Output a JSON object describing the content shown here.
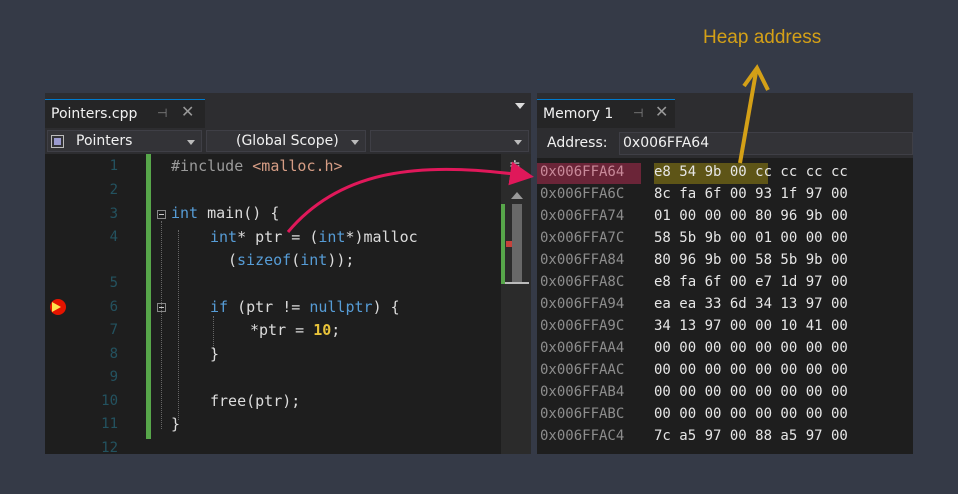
{
  "annotation": {
    "label": "Heap address",
    "label_color": "#d4a017",
    "arrow_color": "#d4a017",
    "pointer_arrow_color": "#e0185a"
  },
  "editor": {
    "tab_title": "Pointers.cpp",
    "pin_glyph": "⊣",
    "close_glyph": "✕",
    "nav": {
      "project": "Pointers",
      "scope": "(Global Scope)",
      "member": ""
    },
    "line_numbers": [
      "1",
      "2",
      "3",
      "4",
      "",
      "5",
      "6",
      "7",
      "8",
      "9",
      "10",
      "11",
      "12"
    ],
    "breakpoint_line": "6",
    "code": {
      "l1_directive": "#include",
      "l1_header": "<malloc.h>",
      "l3_kw": "int",
      "l3_rest": " main() {",
      "l4_kw": "int",
      "l4_rest": "* ptr = (",
      "l4_kw2": "int",
      "l4_rest2": "*)malloc",
      "l4w_open": "(",
      "l4w_kw": "sizeof",
      "l4w_mid": "(",
      "l4w_kw2": "int",
      "l4w_end": "));",
      "l6_kw": "if",
      "l6_mid": " (ptr != ",
      "l6_kw2": "nullptr",
      "l6_end": ") {",
      "l7_pre": "*ptr = ",
      "l7_num": "10",
      "l7_end": ";",
      "l8": "}",
      "l10": "free(ptr);",
      "l11": "}"
    }
  },
  "memory": {
    "tab_title": "Memory 1",
    "pin_glyph": "⊣",
    "close_glyph": "✕",
    "address_label": "Address:",
    "address_value": "0x006FFA64",
    "rows": [
      {
        "addr": "0x006FFA64",
        "hl": "e8 54 9b 00",
        "rest": " cc cc cc cc"
      },
      {
        "addr": "0x006FFA6C",
        "bytes": "8c fa 6f 00 93 1f 97 00"
      },
      {
        "addr": "0x006FFA74",
        "bytes": "01 00 00 00 80 96 9b 00"
      },
      {
        "addr": "0x006FFA7C",
        "bytes": "58 5b 9b 00 01 00 00 00"
      },
      {
        "addr": "0x006FFA84",
        "bytes": "80 96 9b 00 58 5b 9b 00"
      },
      {
        "addr": "0x006FFA8C",
        "bytes": "e8 fa 6f 00 e7 1d 97 00"
      },
      {
        "addr": "0x006FFA94",
        "bytes": "ea ea 33 6d 34 13 97 00"
      },
      {
        "addr": "0x006FFA9C",
        "bytes": "34 13 97 00 00 10 41 00"
      },
      {
        "addr": "0x006FFAA4",
        "bytes": "00 00 00 00 00 00 00 00"
      },
      {
        "addr": "0x006FFAAC",
        "bytes": "00 00 00 00 00 00 00 00"
      },
      {
        "addr": "0x006FFAB4",
        "bytes": "00 00 00 00 00 00 00 00"
      },
      {
        "addr": "0x006FFABC",
        "bytes": "00 00 00 00 00 00 00 00"
      },
      {
        "addr": "0x006FFAC4",
        "bytes": "7c a5 97 00 88 a5 97 00"
      }
    ]
  }
}
